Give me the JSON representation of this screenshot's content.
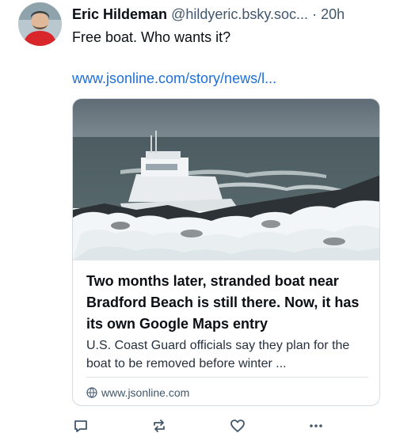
{
  "post": {
    "author_name": "Eric Hildeman",
    "author_handle": "@hildyeric.bsky.soc...",
    "separator": "·",
    "timestamp": "20h",
    "text": "Free boat. Who wants it?",
    "link_text": "www.jsonline.com/story/news/l..."
  },
  "card": {
    "title": "Two months later, stranded boat near Bradford Beach is still there. Now, it has its own Google Maps entry",
    "description": "U.S. Coast Guard officials say they plan for the boat to be removed before winter ...",
    "domain": "www.jsonline.com",
    "domain_icon": "globe-icon"
  },
  "actions": {
    "reply_icon": "reply-icon",
    "repost_icon": "repost-icon",
    "like_icon": "heart-icon",
    "more_icon": "more-icon"
  },
  "colors": {
    "link": "#1d6fd6",
    "muted": "#42576c",
    "border": "#d4dbe2"
  }
}
